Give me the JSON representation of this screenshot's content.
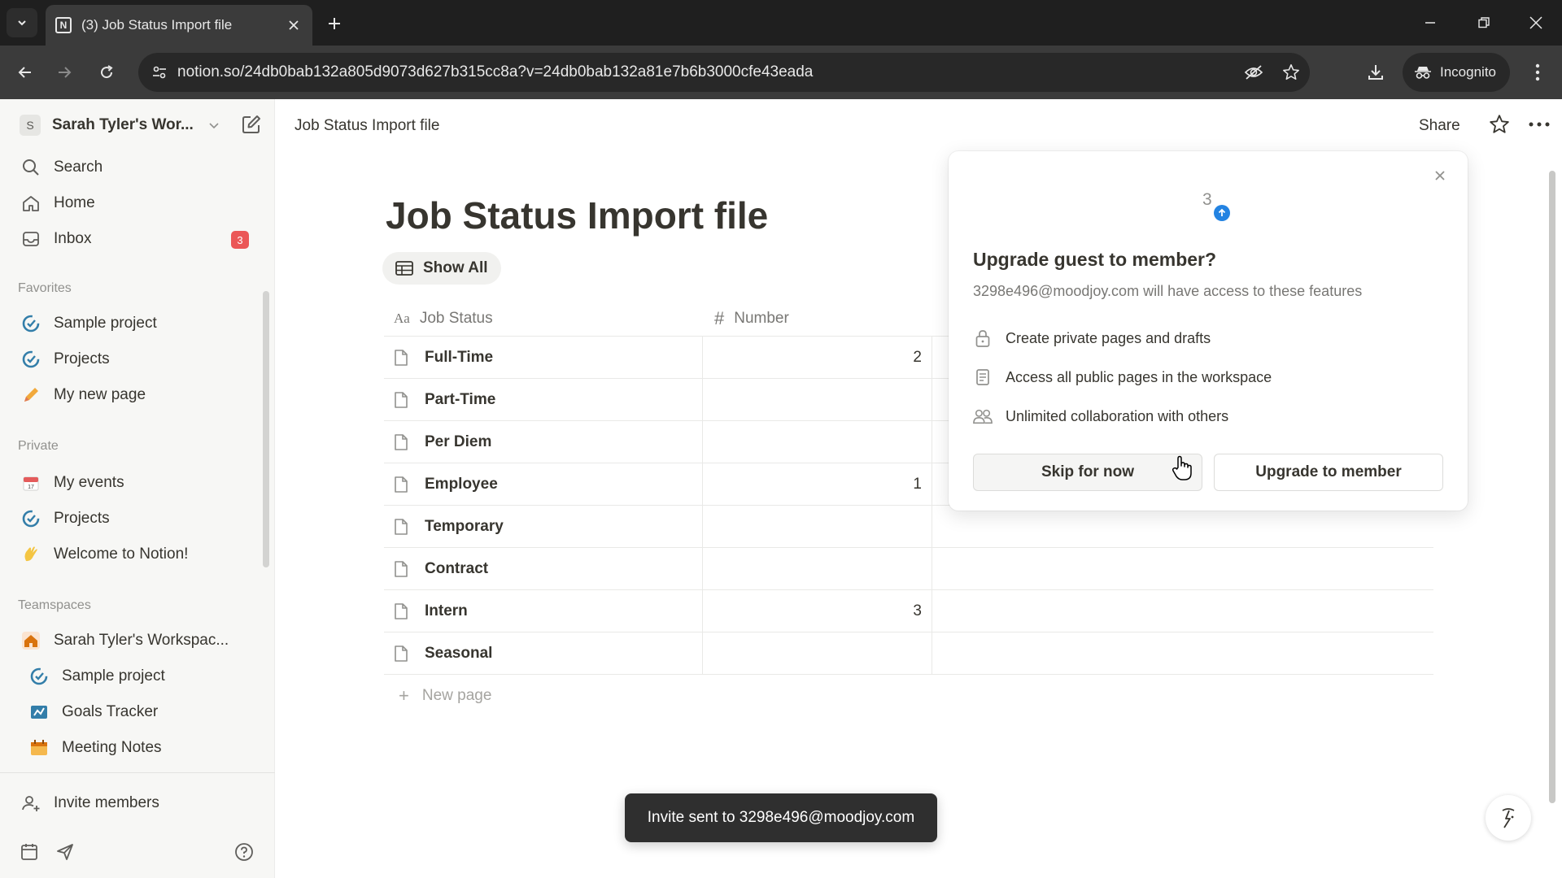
{
  "browser": {
    "tab_title": "(3) Job Status Import file",
    "favicon_letter": "N",
    "url": "notion.so/24db0bab132a805d9073d627b315cc8a?v=24db0bab132a81e7b6b3000cfe43eada",
    "incognito_label": "Incognito"
  },
  "sidebar": {
    "workspace_initial": "S",
    "workspace_name": "Sarah Tyler's Wor...",
    "top_items": [
      {
        "label": "Search",
        "icon": "search-icon"
      },
      {
        "label": "Home",
        "icon": "home-icon"
      },
      {
        "label": "Inbox",
        "icon": "inbox-icon",
        "badge": "3"
      }
    ],
    "favorites_title": "Favorites",
    "favorites": [
      {
        "label": "Sample project",
        "icon": "project-icon"
      },
      {
        "label": "Projects",
        "icon": "project-icon"
      },
      {
        "label": "My new page",
        "icon": "pencil-icon"
      }
    ],
    "private_title": "Private",
    "private": [
      {
        "label": "My events",
        "icon": "calendar-icon"
      },
      {
        "label": "Projects",
        "icon": "project-icon"
      },
      {
        "label": "Welcome to Notion!",
        "icon": "wave-icon"
      }
    ],
    "teamspaces_title": "Teamspaces",
    "teamspaces": [
      {
        "label": "Sarah Tyler's Workspac...",
        "icon": "home-orange-icon"
      },
      {
        "label": "Sample project",
        "icon": "project-icon"
      },
      {
        "label": "Goals Tracker",
        "icon": "goals-icon"
      },
      {
        "label": "Meeting Notes",
        "icon": "meeting-icon"
      }
    ],
    "invite_label": "Invite members"
  },
  "topbar": {
    "breadcrumb": "Job Status Import file",
    "share_label": "Share"
  },
  "page": {
    "title": "Job Status Import file",
    "view_label": "Show All",
    "columns": [
      {
        "label": "Job Status",
        "icon_text": "Aa"
      },
      {
        "label": "Number",
        "icon_text": "#"
      }
    ],
    "rows": [
      {
        "name": "Full-Time",
        "number": "2"
      },
      {
        "name": "Part-Time",
        "number": ""
      },
      {
        "name": "Per Diem",
        "number": ""
      },
      {
        "name": "Employee",
        "number": "1"
      },
      {
        "name": "Temporary",
        "number": ""
      },
      {
        "name": "Contract",
        "number": ""
      },
      {
        "name": "Intern",
        "number": "3"
      },
      {
        "name": "Seasonal",
        "number": ""
      }
    ],
    "new_page_label": "New page"
  },
  "popup": {
    "avatar_text": "3",
    "title": "Upgrade guest to member?",
    "subtitle": "3298e496@moodjoy.com will have access to these features",
    "features": [
      {
        "label": "Create private pages and drafts",
        "icon": "lock-icon"
      },
      {
        "label": "Access all public pages in the workspace",
        "icon": "document-icon"
      },
      {
        "label": "Unlimited collaboration with others",
        "icon": "people-icon"
      }
    ],
    "skip_label": "Skip for now",
    "upgrade_label": "Upgrade to member"
  },
  "toast": {
    "message": "Invite sent to 3298e496@moodjoy.com"
  },
  "colors": {
    "badge": "#eb5757",
    "accent_blue": "#2383e2",
    "sidebar_bg": "#f7f7f5",
    "project_icon": "#337ea9",
    "teamspace_icon": "#d9730d"
  }
}
